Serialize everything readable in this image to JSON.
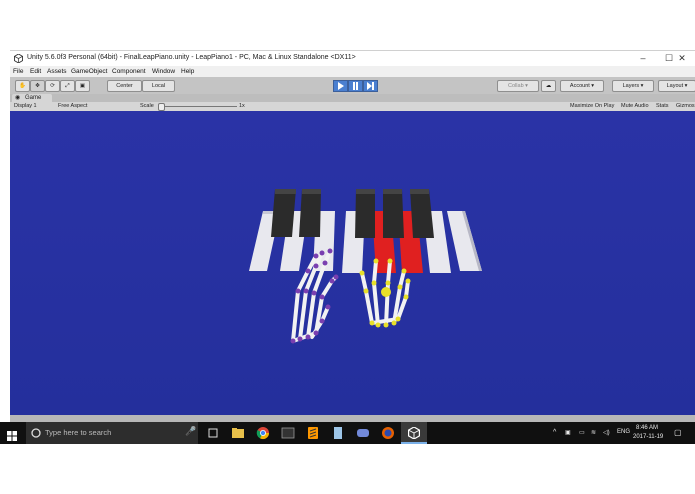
{
  "window": {
    "title": "Unity 5.6.0f3 Personal (64bit) - FinalLeapPiano.unity - LeapPiano1 - PC, Mac & Linux Standalone <DX11>",
    "minimize": "–",
    "maximize": "☐",
    "close": "✕"
  },
  "menu": [
    "File",
    "Edit",
    "Assets",
    "GameObject",
    "Component",
    "Window",
    "Help"
  ],
  "toolbar": {
    "pivot": "Center",
    "space": "Local",
    "collab": "Collab ▾",
    "account": "Account ▾",
    "layers": "Layers ▾",
    "layout": "Layout ▾"
  },
  "game_view": {
    "tab": "Game",
    "display": "Display 1",
    "aspect": "Free Aspect",
    "scale_label": "Scale",
    "scale_value": "1x",
    "options": [
      "Maximize On Play",
      "Mute Audio",
      "Stats",
      "Gizmos"
    ]
  },
  "taskbar": {
    "search_placeholder": "Type here to search",
    "lang": "ENG",
    "time": "8:46 AM",
    "date": "2017-11-19"
  },
  "colors": {
    "scene_bg": "#2732a2",
    "pressed_key": "#e02020",
    "left_hand_joints": "#7a3fb0",
    "right_hand_joints": "#e8e02a",
    "play_button": "#4a7fd0"
  }
}
